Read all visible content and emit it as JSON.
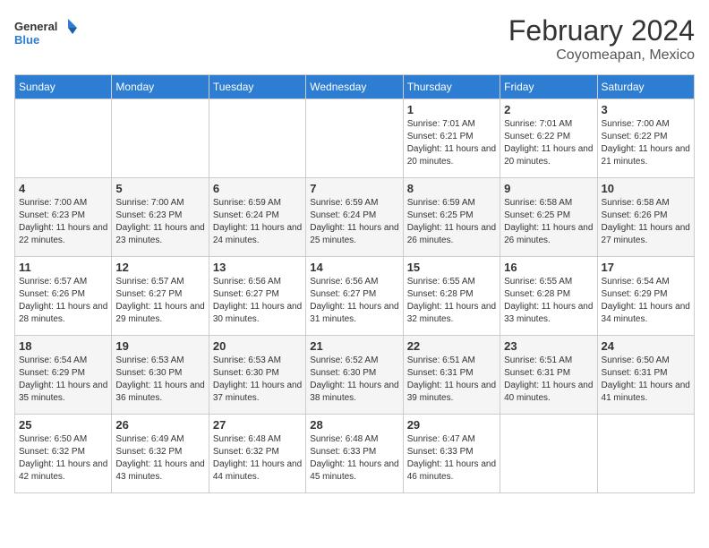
{
  "logo": {
    "line1": "General",
    "line2": "Blue"
  },
  "title": "February 2024",
  "location": "Coyomeapan, Mexico",
  "days_of_week": [
    "Sunday",
    "Monday",
    "Tuesday",
    "Wednesday",
    "Thursday",
    "Friday",
    "Saturday"
  ],
  "weeks": [
    [
      {
        "day": "",
        "info": ""
      },
      {
        "day": "",
        "info": ""
      },
      {
        "day": "",
        "info": ""
      },
      {
        "day": "",
        "info": ""
      },
      {
        "day": "1",
        "info": "Sunrise: 7:01 AM\nSunset: 6:21 PM\nDaylight: 11 hours and 20 minutes."
      },
      {
        "day": "2",
        "info": "Sunrise: 7:01 AM\nSunset: 6:22 PM\nDaylight: 11 hours and 20 minutes."
      },
      {
        "day": "3",
        "info": "Sunrise: 7:00 AM\nSunset: 6:22 PM\nDaylight: 11 hours and 21 minutes."
      }
    ],
    [
      {
        "day": "4",
        "info": "Sunrise: 7:00 AM\nSunset: 6:23 PM\nDaylight: 11 hours and 22 minutes."
      },
      {
        "day": "5",
        "info": "Sunrise: 7:00 AM\nSunset: 6:23 PM\nDaylight: 11 hours and 23 minutes."
      },
      {
        "day": "6",
        "info": "Sunrise: 6:59 AM\nSunset: 6:24 PM\nDaylight: 11 hours and 24 minutes."
      },
      {
        "day": "7",
        "info": "Sunrise: 6:59 AM\nSunset: 6:24 PM\nDaylight: 11 hours and 25 minutes."
      },
      {
        "day": "8",
        "info": "Sunrise: 6:59 AM\nSunset: 6:25 PM\nDaylight: 11 hours and 26 minutes."
      },
      {
        "day": "9",
        "info": "Sunrise: 6:58 AM\nSunset: 6:25 PM\nDaylight: 11 hours and 26 minutes."
      },
      {
        "day": "10",
        "info": "Sunrise: 6:58 AM\nSunset: 6:26 PM\nDaylight: 11 hours and 27 minutes."
      }
    ],
    [
      {
        "day": "11",
        "info": "Sunrise: 6:57 AM\nSunset: 6:26 PM\nDaylight: 11 hours and 28 minutes."
      },
      {
        "day": "12",
        "info": "Sunrise: 6:57 AM\nSunset: 6:27 PM\nDaylight: 11 hours and 29 minutes."
      },
      {
        "day": "13",
        "info": "Sunrise: 6:56 AM\nSunset: 6:27 PM\nDaylight: 11 hours and 30 minutes."
      },
      {
        "day": "14",
        "info": "Sunrise: 6:56 AM\nSunset: 6:27 PM\nDaylight: 11 hours and 31 minutes."
      },
      {
        "day": "15",
        "info": "Sunrise: 6:55 AM\nSunset: 6:28 PM\nDaylight: 11 hours and 32 minutes."
      },
      {
        "day": "16",
        "info": "Sunrise: 6:55 AM\nSunset: 6:28 PM\nDaylight: 11 hours and 33 minutes."
      },
      {
        "day": "17",
        "info": "Sunrise: 6:54 AM\nSunset: 6:29 PM\nDaylight: 11 hours and 34 minutes."
      }
    ],
    [
      {
        "day": "18",
        "info": "Sunrise: 6:54 AM\nSunset: 6:29 PM\nDaylight: 11 hours and 35 minutes."
      },
      {
        "day": "19",
        "info": "Sunrise: 6:53 AM\nSunset: 6:30 PM\nDaylight: 11 hours and 36 minutes."
      },
      {
        "day": "20",
        "info": "Sunrise: 6:53 AM\nSunset: 6:30 PM\nDaylight: 11 hours and 37 minutes."
      },
      {
        "day": "21",
        "info": "Sunrise: 6:52 AM\nSunset: 6:30 PM\nDaylight: 11 hours and 38 minutes."
      },
      {
        "day": "22",
        "info": "Sunrise: 6:51 AM\nSunset: 6:31 PM\nDaylight: 11 hours and 39 minutes."
      },
      {
        "day": "23",
        "info": "Sunrise: 6:51 AM\nSunset: 6:31 PM\nDaylight: 11 hours and 40 minutes."
      },
      {
        "day": "24",
        "info": "Sunrise: 6:50 AM\nSunset: 6:31 PM\nDaylight: 11 hours and 41 minutes."
      }
    ],
    [
      {
        "day": "25",
        "info": "Sunrise: 6:50 AM\nSunset: 6:32 PM\nDaylight: 11 hours and 42 minutes."
      },
      {
        "day": "26",
        "info": "Sunrise: 6:49 AM\nSunset: 6:32 PM\nDaylight: 11 hours and 43 minutes."
      },
      {
        "day": "27",
        "info": "Sunrise: 6:48 AM\nSunset: 6:32 PM\nDaylight: 11 hours and 44 minutes."
      },
      {
        "day": "28",
        "info": "Sunrise: 6:48 AM\nSunset: 6:33 PM\nDaylight: 11 hours and 45 minutes."
      },
      {
        "day": "29",
        "info": "Sunrise: 6:47 AM\nSunset: 6:33 PM\nDaylight: 11 hours and 46 minutes."
      },
      {
        "day": "",
        "info": ""
      },
      {
        "day": "",
        "info": ""
      }
    ]
  ]
}
